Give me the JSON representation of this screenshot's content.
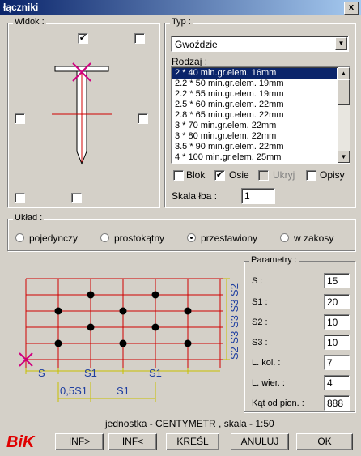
{
  "window": {
    "title": "łączniki",
    "close_label": "x"
  },
  "widok": {
    "label": "Widok :",
    "top_checkbox_mark": "✔"
  },
  "typ": {
    "label": "Typ :",
    "selected": "Gwoździe",
    "rodzaj_label": "Rodzaj :",
    "items": [
      "2 * 40 min.gr.elem. 16mm",
      "2.2 * 50 min.gr.elem. 19mm",
      "2.2 * 55 min.gr.elem. 19mm",
      "2.5 * 60 min.gr.elem. 22mm",
      "2.8 * 65 min.gr.elem. 22mm",
      "3 * 70 min.gr.elem. 22mm",
      "3 * 80 min.gr.elem. 22mm",
      "3.5 * 90 min.gr.elem. 22mm",
      "4 * 100 min.gr.elem. 25mm"
    ],
    "options": {
      "blok": "Blok",
      "osie": "Osie",
      "ukryj": "Ukryj",
      "opisy": "Opisy",
      "check_mark": "✔"
    },
    "skala_label": "Skala łba :",
    "skala_value": "1"
  },
  "uklad": {
    "label": "Układ :",
    "options": [
      "pojedynczy",
      "prostokątny",
      "przestawiony",
      "w zakosy"
    ],
    "selected": "przestawiony"
  },
  "diagram": {
    "vertical_labels": "S2 S3 S3 S3 S2",
    "s": "S",
    "s1a": "S1",
    "s1b": "S1",
    "half_s1": "0,5S1",
    "s1c": "S1"
  },
  "parametry": {
    "label": "Parametry :",
    "rows": [
      {
        "label": "S :",
        "value": "15"
      },
      {
        "label": "S1 :",
        "value": "20"
      },
      {
        "label": "S2 :",
        "value": "10"
      },
      {
        "label": "S3 :",
        "value": "10"
      },
      {
        "label": "L. kol. :",
        "value": "7"
      },
      {
        "label": "L. wier. :",
        "value": "4"
      },
      {
        "label": "Kąt od pion. :",
        "value": "888"
      }
    ]
  },
  "status": "jednostka - CENTYMETR  ,  skala - 1:50",
  "logo": "BiK",
  "buttons": {
    "inf_next": "INF>",
    "inf_prev": "INF<",
    "kresl": "KREŚL",
    "anuluj": "ANULUJ",
    "ok": "OK"
  }
}
